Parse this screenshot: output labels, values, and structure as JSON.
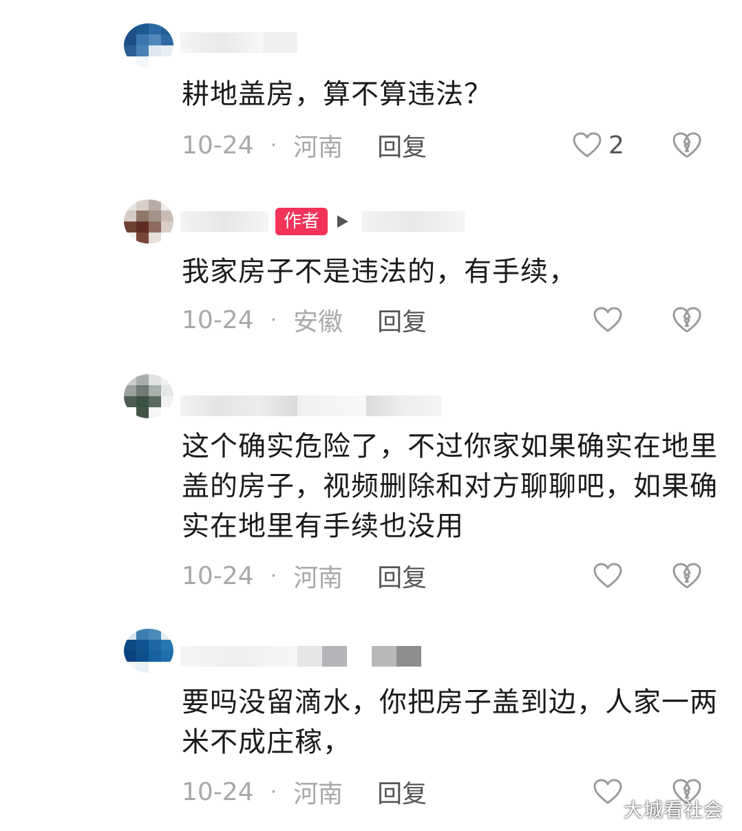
{
  "comments": [
    {
      "text": "耕地盖房，算不算违法？",
      "date": "10-24",
      "separator": "·",
      "location": "河南",
      "reply_label": "回复",
      "like_count": "2"
    },
    {
      "author_badge": "作者",
      "text": "我家房子不是违法的，有手续，",
      "date": "10-24",
      "separator": "·",
      "location": "安徽",
      "reply_label": "回复",
      "like_count": ""
    },
    {
      "text": "这个确实危险了，不过你家如果确实在地里盖的房子，视频删除和对方聊聊吧，如果确实在地里有手续也没用",
      "date": "10-24",
      "separator": "·",
      "location": "河南",
      "reply_label": "回复",
      "like_count": ""
    },
    {
      "text": "要吗没留滴水，你把房子盖到边，人家一两米不成庄稼，",
      "date": "10-24",
      "separator": "·",
      "location": "河南",
      "reply_label": "回复",
      "like_count": ""
    }
  ],
  "watermark": "大城看社会",
  "icons": {
    "like": "heart-outline-icon",
    "dislike": "broken-heart-icon"
  },
  "colors": {
    "author_badge": "#f2335a",
    "meta_text": "#a8a8a8",
    "reply_text": "#555555",
    "body_text": "#1a1a1a"
  }
}
